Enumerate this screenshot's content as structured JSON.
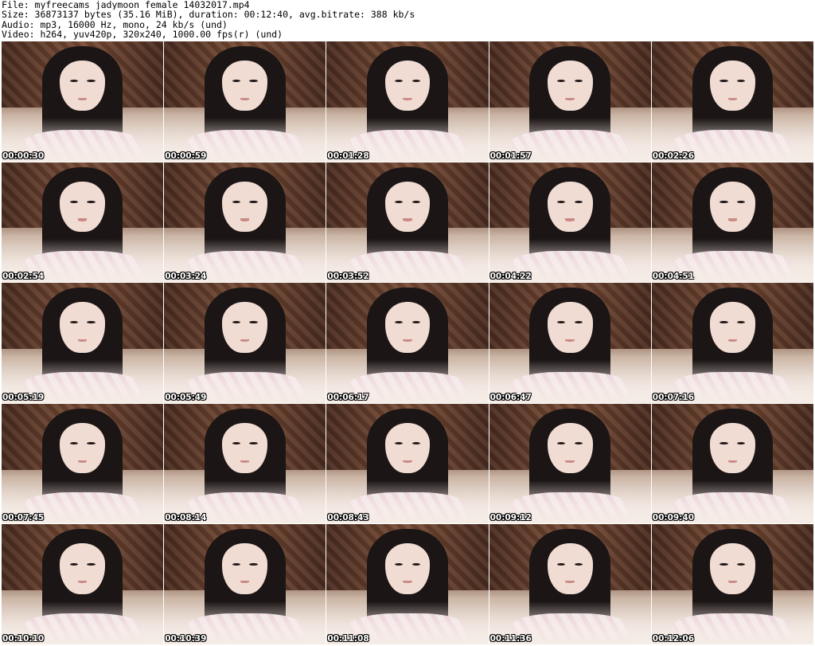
{
  "header": {
    "file_line": "File: myfreecams_jadymoon_female_14032017.mp4",
    "size_line": "Size: 36873137 bytes (35.16 MiB), duration: 00:12:40, avg.bitrate: 388 kb/s",
    "audio_line": "Audio: mp3, 16000 Hz, mono, 24 kb/s (und)",
    "video_line": "Video: h264, yuv420p, 320x240, 1000.00 fps(r) (und)"
  },
  "thumbnails": [
    {
      "timestamp": "00:00:30"
    },
    {
      "timestamp": "00:00:59"
    },
    {
      "timestamp": "00:01:28"
    },
    {
      "timestamp": "00:01:57"
    },
    {
      "timestamp": "00:02:26"
    },
    {
      "timestamp": "00:02:54"
    },
    {
      "timestamp": "00:03:24"
    },
    {
      "timestamp": "00:03:52"
    },
    {
      "timestamp": "00:04:22"
    },
    {
      "timestamp": "00:04:51"
    },
    {
      "timestamp": "00:05:19"
    },
    {
      "timestamp": "00:05:49"
    },
    {
      "timestamp": "00:06:17"
    },
    {
      "timestamp": "00:06:47"
    },
    {
      "timestamp": "00:07:16"
    },
    {
      "timestamp": "00:07:45"
    },
    {
      "timestamp": "00:08:14"
    },
    {
      "timestamp": "00:08:43"
    },
    {
      "timestamp": "00:09:12"
    },
    {
      "timestamp": "00:09:40"
    },
    {
      "timestamp": "00:10:10"
    },
    {
      "timestamp": "00:10:39"
    },
    {
      "timestamp": "00:11:08"
    },
    {
      "timestamp": "00:11:36"
    },
    {
      "timestamp": "00:12:06"
    }
  ]
}
